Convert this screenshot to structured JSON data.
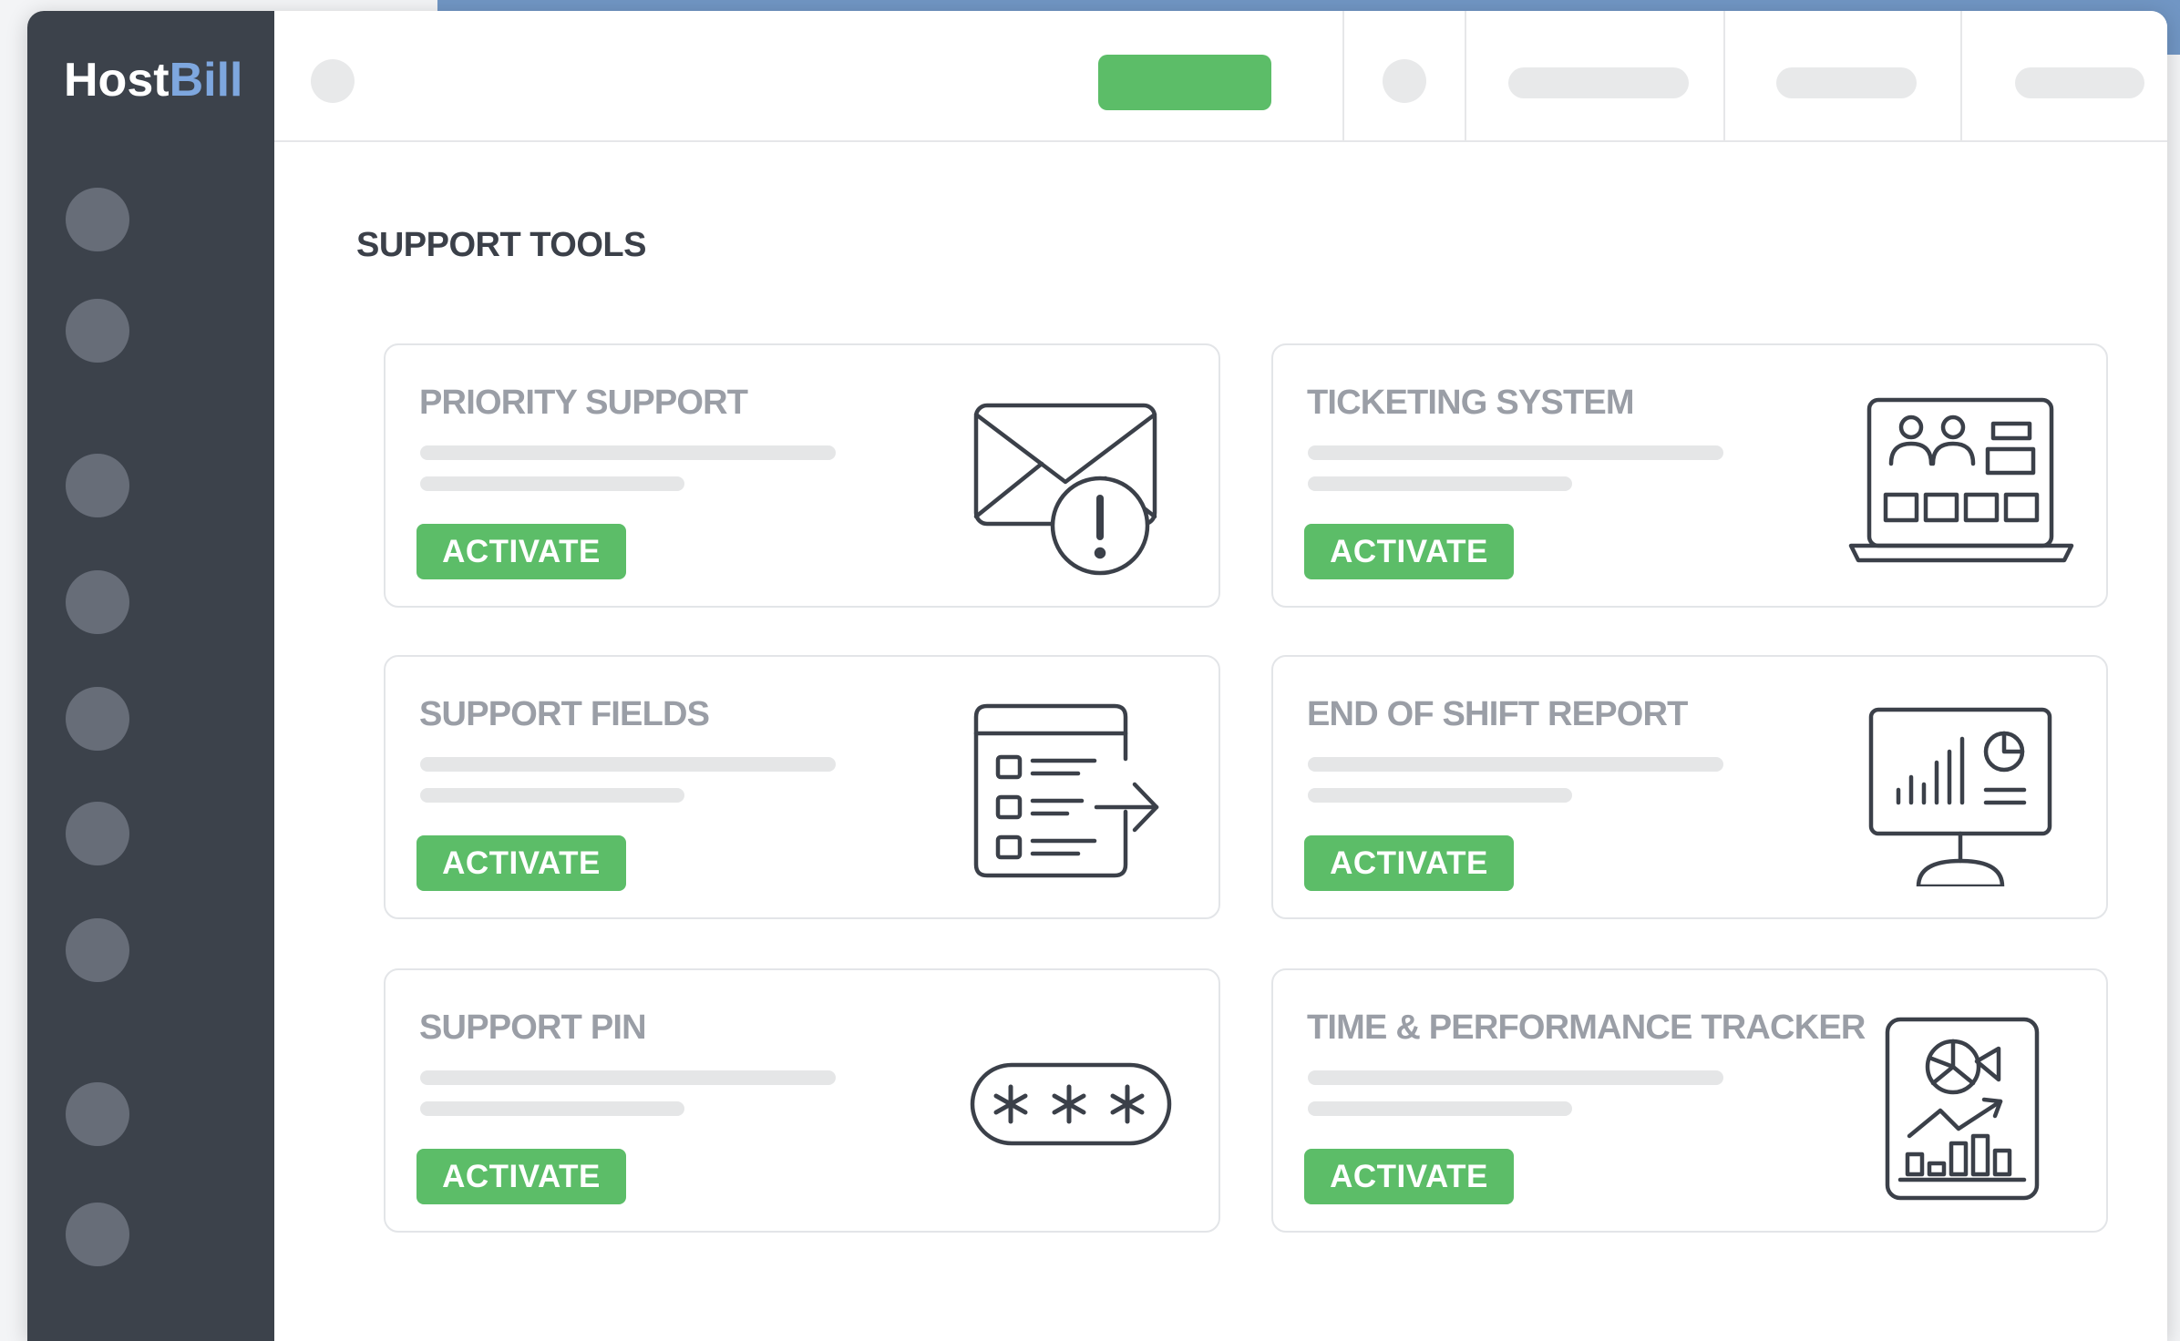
{
  "app": {
    "logo_primary": "Host",
    "logo_accent": "Bill"
  },
  "colors": {
    "sidebar": "#3c424b",
    "accent_green": "#5cbd68",
    "logo_accent": "#7ea7df",
    "card_title": "#9a9ea6"
  },
  "main": {
    "section_title": "SUPPORT TOOLS",
    "cards": [
      {
        "title": "PRIORITY SUPPORT",
        "button_label": "ACTIVATE",
        "icon": "envelope-alert-icon"
      },
      {
        "title": "TICKETING SYSTEM",
        "button_label": "ACTIVATE",
        "icon": "laptop-kanban-icon"
      },
      {
        "title": "SUPPORT FIELDS",
        "button_label": "ACTIVATE",
        "icon": "form-checklist-icon"
      },
      {
        "title": "END OF SHIFT REPORT",
        "button_label": "ACTIVATE",
        "icon": "monitor-chart-icon"
      },
      {
        "title": "SUPPORT PIN",
        "button_label": "ACTIVATE",
        "icon": "pin-password-icon"
      },
      {
        "title": "TIME & PERFORMANCE TRACKER",
        "button_label": "ACTIVATE",
        "icon": "tablet-analytics-icon"
      }
    ]
  }
}
